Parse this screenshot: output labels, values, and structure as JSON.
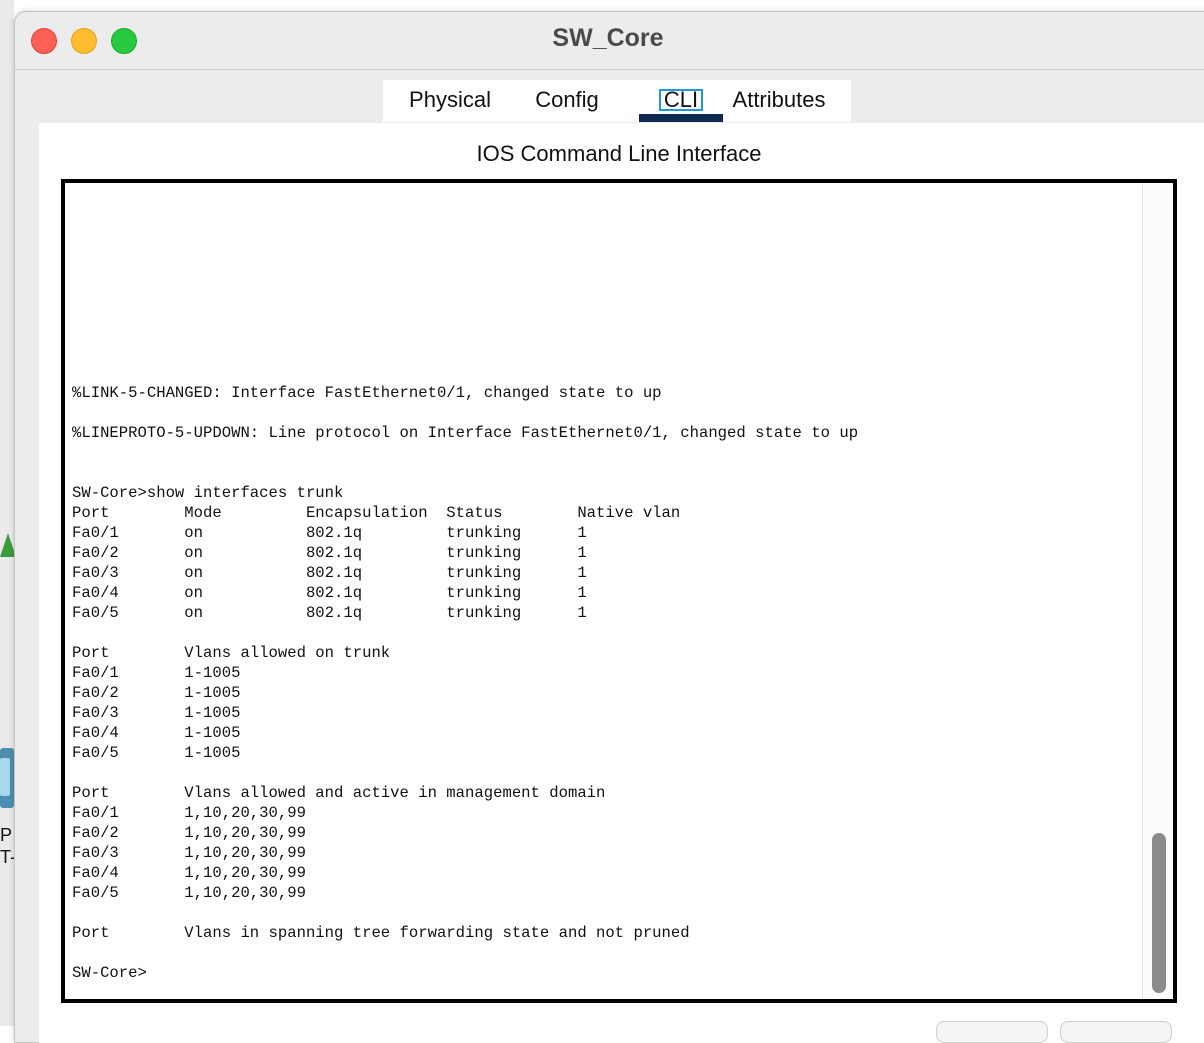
{
  "background_app": {
    "partial_labels": [
      "P",
      "T-"
    ]
  },
  "window": {
    "title": "SW_Core",
    "traffic_lights": [
      "close",
      "minimize",
      "zoom"
    ]
  },
  "tabs": [
    {
      "label": "Physical",
      "selected": false
    },
    {
      "label": "Config",
      "selected": false
    },
    {
      "label": "CLI",
      "selected": true
    },
    {
      "label": "Attributes",
      "selected": false
    }
  ],
  "cli": {
    "heading": "IOS Command Line Interface",
    "output": "\n\n\n\n\n\n\n\n\n\n%LINK-5-CHANGED: Interface FastEthernet0/1, changed state to up\n\n%LINEPROTO-5-UPDOWN: Line protocol on Interface FastEthernet0/1, changed state to up\n\n\nSW-Core>show interfaces trunk\nPort        Mode         Encapsulation  Status        Native vlan\nFa0/1       on           802.1q         trunking      1\nFa0/2       on           802.1q         trunking      1\nFa0/3       on           802.1q         trunking      1\nFa0/4       on           802.1q         trunking      1\nFa0/5       on           802.1q         trunking      1\n\nPort        Vlans allowed on trunk\nFa0/1       1-1005\nFa0/2       1-1005\nFa0/3       1-1005\nFa0/4       1-1005\nFa0/5       1-1005\n\nPort        Vlans allowed and active in management domain\nFa0/1       1,10,20,30,99\nFa0/2       1,10,20,30,99\nFa0/3       1,10,20,30,99\nFa0/4       1,10,20,30,99\nFa0/5       1,10,20,30,99\n\nPort        Vlans in spanning tree forwarding state and not pruned\n\nSW-Core>"
  },
  "colors": {
    "tab_underline": "#0e2a52",
    "cli_focus_ring": "#1e9bd7",
    "close": "#fe5f57",
    "minimize": "#febc2e",
    "zoom": "#28c840"
  }
}
